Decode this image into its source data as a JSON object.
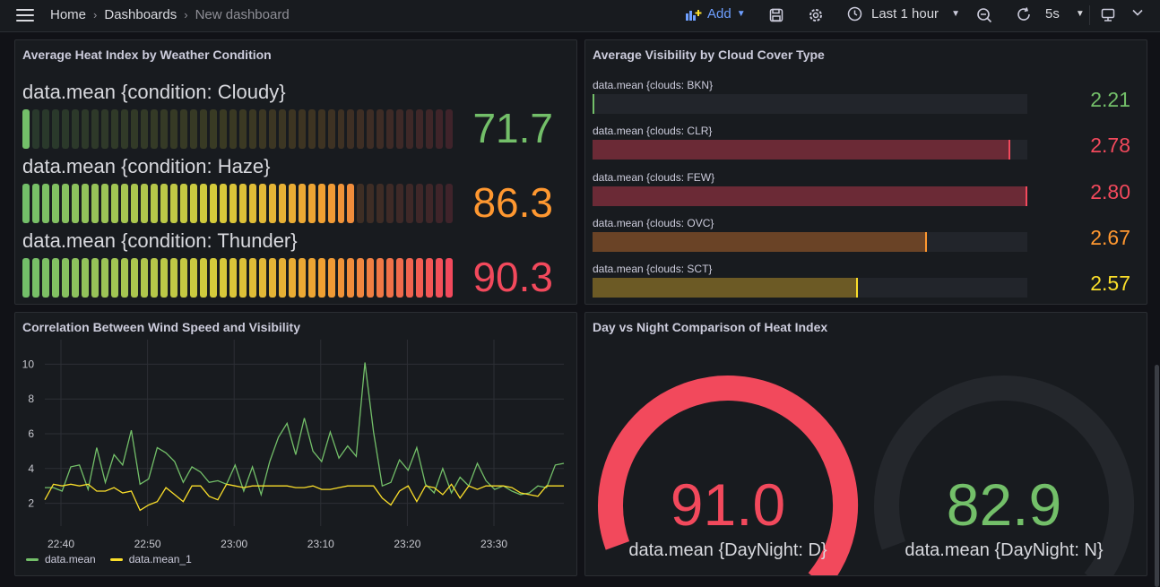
{
  "breadcrumb": {
    "home": "Home",
    "dashboards": "Dashboards",
    "current": "New dashboard"
  },
  "toolbar": {
    "add_label": "Add",
    "time_range": "Last 1 hour",
    "refresh_interval": "5s"
  },
  "colors": {
    "green": "#73bf69",
    "yellow": "#fade2a",
    "orange": "#ff9830",
    "red": "#f2495c",
    "accent": "#6e9fff"
  },
  "panels": {
    "heat_index": {
      "title": "Average Heat Index by Weather Condition",
      "rows": [
        {
          "label": "data.mean {condition: Cloudy}",
          "value": "71.7",
          "level": 0.03,
          "color": "#73bf69"
        },
        {
          "label": "data.mean {condition: Haze}",
          "value": "86.3",
          "level": 0.78,
          "color": "#ff9830"
        },
        {
          "label": "data.mean {condition: Thunder}",
          "value": "90.3",
          "level": 1.0,
          "color": "#f2495c"
        }
      ]
    },
    "visibility": {
      "title": "Average Visibility by Cloud Cover Type",
      "rows": [
        {
          "label": "data.mean {clouds: BKN}",
          "value": "2.21",
          "level": 0.0,
          "color": "#73bf69"
        },
        {
          "label": "data.mean {clouds: CLR}",
          "value": "2.78",
          "level": 0.96,
          "color": "#f2495c"
        },
        {
          "label": "data.mean {clouds: FEW}",
          "value": "2.80",
          "level": 1.0,
          "color": "#f2495c"
        },
        {
          "label": "data.mean {clouds: OVC}",
          "value": "2.67",
          "level": 0.77,
          "color": "#ff9830"
        },
        {
          "label": "data.mean {clouds: SCT}",
          "value": "2.57",
          "level": 0.61,
          "color": "#fade2a"
        }
      ]
    },
    "wind": {
      "title": "Correlation Between Wind Speed and Visibility"
    },
    "day_night": {
      "title": "Day vs Night Comparison of Heat Index",
      "gauges": [
        {
          "label": "data.mean {DayNight: D}",
          "value": "91.0",
          "level": 1.0,
          "color": "#f2495c"
        },
        {
          "label": "data.mean {DayNight: N}",
          "value": "82.9",
          "level": 0.0,
          "color": "#73bf69"
        }
      ]
    }
  },
  "chart_data": {
    "type": "line",
    "title": "Correlation Between Wind Speed and Visibility",
    "x_ticks": [
      "22:40",
      "22:50",
      "23:00",
      "23:10",
      "23:20",
      "23:30"
    ],
    "y_ticks": [
      "2",
      "4",
      "6",
      "8",
      "10"
    ],
    "ylim": [
      1,
      11
    ],
    "grid": true,
    "legend_placement": "bottom-left",
    "series": [
      {
        "name": "data.mean",
        "color": "#73bf69",
        "values": [
          2.9,
          2.9,
          2.7,
          4.1,
          4.2,
          2.8,
          5.2,
          3.2,
          4.8,
          4.2,
          6.2,
          3.1,
          3.4,
          5.2,
          4.9,
          4.4,
          3.2,
          4.1,
          3.8,
          3.2,
          3.3,
          3.1,
          4.2,
          2.7,
          4.1,
          2.5,
          4.4,
          5.8,
          6.6,
          4.8,
          6.9,
          5.0,
          4.4,
          6.1,
          4.6,
          5.3,
          4.7,
          10.1,
          6.1,
          3.0,
          3.2,
          4.5,
          3.9,
          5.2,
          3.1,
          2.6,
          4.0,
          2.6,
          3.5,
          3.0,
          4.3,
          3.3,
          2.8,
          3.0,
          2.7,
          2.5,
          2.6,
          3.0,
          2.9,
          4.2,
          4.3
        ]
      },
      {
        "name": "data.mean_1",
        "color": "#fade2a",
        "values": [
          2.2,
          3.1,
          3.0,
          3.1,
          3.0,
          3.1,
          2.7,
          2.7,
          2.9,
          2.6,
          2.7,
          1.6,
          1.9,
          2.1,
          2.9,
          2.5,
          2.1,
          3.0,
          3.0,
          2.4,
          2.2,
          3.1,
          3.0,
          2.9,
          3.0,
          3.0,
          3.0,
          3.0,
          3.0,
          2.9,
          2.9,
          3.0,
          2.8,
          2.8,
          2.9,
          3.0,
          3.0,
          3.0,
          3.0,
          2.3,
          1.9,
          2.7,
          3.0,
          2.1,
          3.0,
          2.9,
          2.5,
          3.1,
          2.3,
          3.0,
          2.8,
          3.0,
          3.0,
          3.0,
          2.9,
          2.6,
          2.5,
          2.4,
          3.0,
          3.0,
          3.0
        ]
      }
    ]
  }
}
